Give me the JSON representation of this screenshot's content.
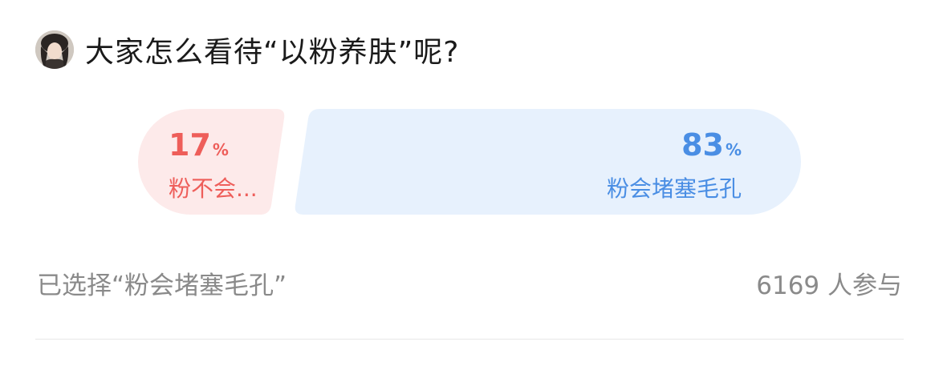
{
  "post": {
    "title": "大家怎么看待“以粉养肤”呢?"
  },
  "poll": {
    "options": [
      {
        "percent": "17",
        "label": "粉不会...",
        "color": "#ee5e5a",
        "bg": "#fdeaea"
      },
      {
        "percent": "83",
        "label": "粉会堵塞毛孔",
        "color": "#4a8ee4",
        "bg": "#e7f1fd"
      }
    ],
    "percent_sign": "%",
    "selected_text": "已选择“粉会堵塞毛孔”",
    "participants": "6169 人参与"
  }
}
